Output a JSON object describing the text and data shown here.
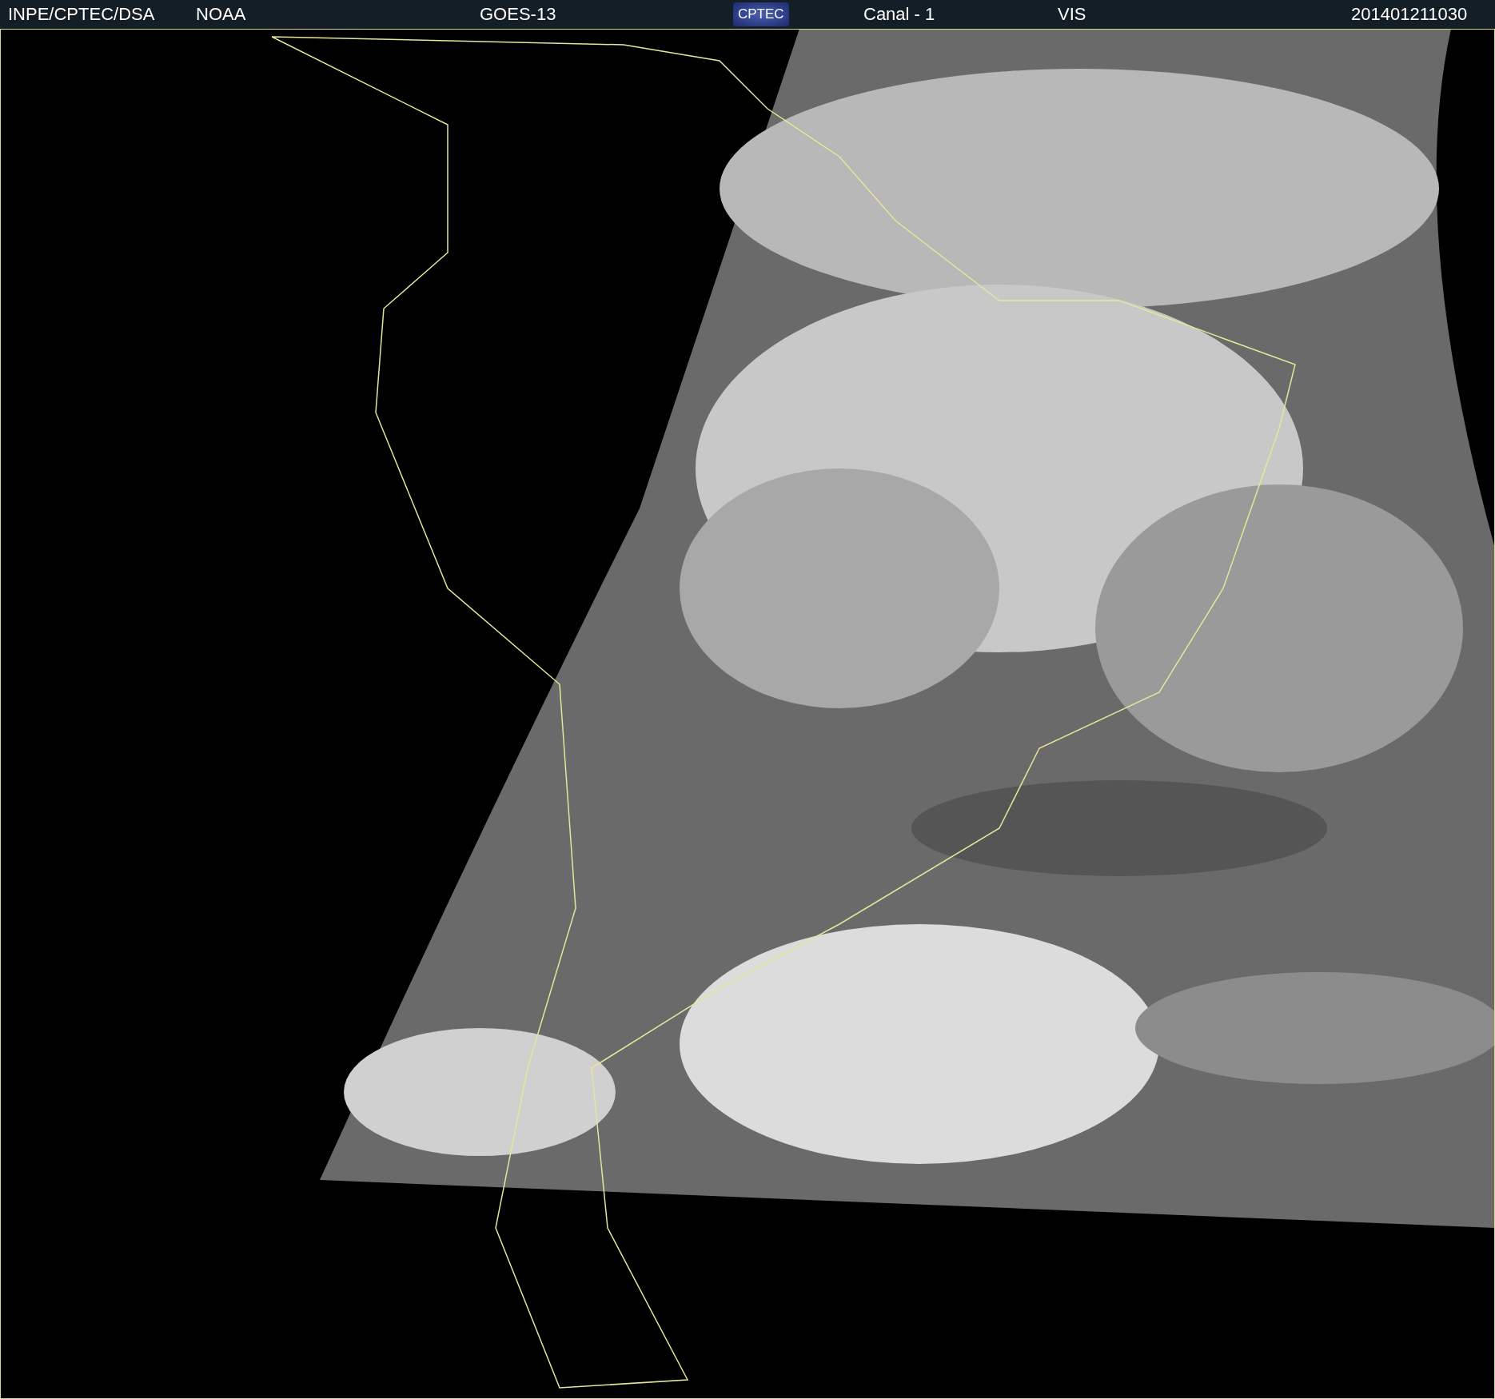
{
  "header": {
    "items": [
      {
        "kind": "text",
        "text": "INPE/CPTEC/DSA"
      },
      {
        "kind": "text",
        "text": "NOAA"
      },
      {
        "kind": "text",
        "text": "GOES-13"
      },
      {
        "kind": "logo",
        "text": "CPTEC"
      },
      {
        "kind": "text",
        "text": "Canal - 1"
      },
      {
        "kind": "text",
        "text": "VIS"
      },
      {
        "kind": "text",
        "text": "201401211030"
      }
    ]
  }
}
